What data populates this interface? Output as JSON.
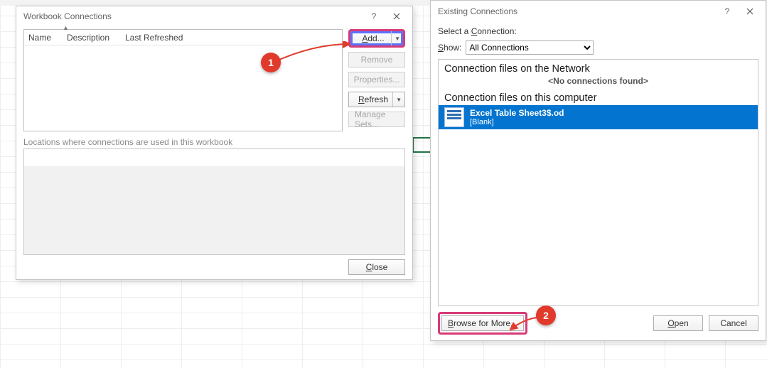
{
  "workbook_conn": {
    "title": "Workbook Connections",
    "cols": {
      "name": "Name",
      "description": "Description",
      "last_refreshed": "Last Refreshed"
    },
    "buttons": {
      "add": "Add...",
      "remove": "Remove",
      "properties": "Properties...",
      "refresh": "Refresh",
      "manage_sets": "Manage Sets..."
    },
    "used_label": "Locations where connections are used in this workbook",
    "close": "Close"
  },
  "existing_conn": {
    "title": "Existing Connections",
    "select_label": "Select a Connection:",
    "show_label": "Show:",
    "show_value": "All Connections",
    "section_network": "Connection files on the Network",
    "none_found": "<No connections found>",
    "section_computer": "Connection files on this computer",
    "item": {
      "name": "Excel Table Sheet3$.od",
      "sub": "[Blank]"
    },
    "browse": "Browse for More...",
    "open": "Open",
    "cancel": "Cancel"
  },
  "callouts": {
    "one": "1",
    "two": "2"
  }
}
